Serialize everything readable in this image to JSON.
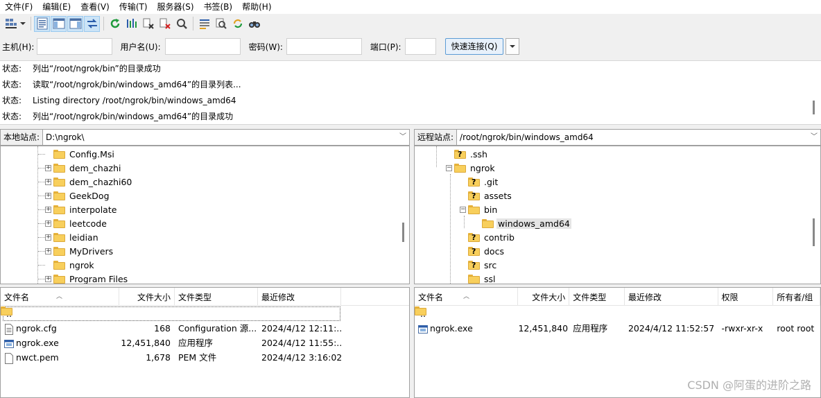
{
  "menu": [
    "文件(F)",
    "编辑(E)",
    "查看(V)",
    "传输(T)",
    "服务器(S)",
    "书签(B)",
    "帮助(H)"
  ],
  "toolbar": {
    "icons": [
      "site-manager-icon",
      "dropdown-arrow-icon",
      "message-log-icon",
      "local-tree-icon",
      "remote-tree-icon",
      "transfer-queue-icon",
      "refresh-icon",
      "process-queue-icon",
      "cancel-icon",
      "disconnect-icon",
      "reconnect-icon",
      "directory-filter-icon",
      "compare-icon",
      "sync-browse-icon",
      "search-files-icon"
    ]
  },
  "quickconnect": {
    "host_label": "主机(H):",
    "user_label": "用户名(U):",
    "pass_label": "密码(W):",
    "port_label": "端口(P):",
    "host_value": "",
    "user_value": "",
    "pass_value": "",
    "port_value": "",
    "connect_label": "快速连接(Q)"
  },
  "log": [
    {
      "k": "状态:",
      "v": "列出“/root/ngrok/bin”的目录成功"
    },
    {
      "k": "状态:",
      "v": "读取“/root/ngrok/bin/windows_amd64”的目录列表..."
    },
    {
      "k": "状态:",
      "v": "Listing directory /root/ngrok/bin/windows_amd64"
    },
    {
      "k": "状态:",
      "v": "列出“/root/ngrok/bin/windows_amd64”的目录成功"
    }
  ],
  "local": {
    "site_label": "本地站点:",
    "path": "D:\\ngrok\\",
    "tree": [
      {
        "name": "Config.Msi",
        "expander": false
      },
      {
        "name": "dem_chazhi",
        "expander": true
      },
      {
        "name": "dem_chazhi60",
        "expander": true
      },
      {
        "name": "GeekDog",
        "expander": true
      },
      {
        "name": "interpolate",
        "expander": true
      },
      {
        "name": "leetcode",
        "expander": true
      },
      {
        "name": "leidian",
        "expander": true
      },
      {
        "name": "MyDrivers",
        "expander": true
      },
      {
        "name": "ngrok",
        "expander": false
      },
      {
        "name": "Program Files",
        "expander": true
      }
    ],
    "columns": [
      "文件名",
      "文件大小",
      "文件类型",
      "最近修改"
    ],
    "files": [
      {
        "name": "..",
        "size": "",
        "type": "",
        "modified": "",
        "icon": "folder-icon"
      },
      {
        "name": "ngrok.cfg",
        "size": "168",
        "type": "Configuration 源...",
        "modified": "2024/4/12 12:11:...",
        "icon": "text-file-icon"
      },
      {
        "name": "ngrok.exe",
        "size": "12,451,840",
        "type": "应用程序",
        "modified": "2024/4/12 11:55:...",
        "icon": "exe-file-icon"
      },
      {
        "name": "nwct.pem",
        "size": "1,678",
        "type": "PEM 文件",
        "modified": "2024/4/12 3:16:02",
        "icon": "blank-file-icon"
      }
    ]
  },
  "remote": {
    "site_label": "远程站点:",
    "path": "/root/ngrok/bin/windows_amd64",
    "tree": [
      {
        "name": ".ssh",
        "unknown": true
      },
      {
        "name": "ngrok",
        "unknown": false,
        "expander": "−"
      },
      {
        "name": ".git",
        "unknown": true
      },
      {
        "name": "assets",
        "unknown": true
      },
      {
        "name": "bin",
        "unknown": false,
        "expander": "−"
      },
      {
        "name": "windows_amd64",
        "unknown": false,
        "selected": true
      },
      {
        "name": "contrib",
        "unknown": true
      },
      {
        "name": "docs",
        "unknown": true
      },
      {
        "name": "src",
        "unknown": true
      },
      {
        "name": "ssl",
        "unknown": false
      }
    ],
    "columns": [
      "文件名",
      "文件大小",
      "文件类型",
      "最近修改",
      "权限",
      "所有者/组"
    ],
    "files": [
      {
        "name": "..",
        "size": "",
        "type": "",
        "modified": "",
        "perm": "",
        "owner": "",
        "icon": "folder-icon"
      },
      {
        "name": "ngrok.exe",
        "size": "12,451,840",
        "type": "应用程序",
        "modified": "2024/4/12 11:52:57",
        "perm": "-rwxr-xr-x",
        "owner": "root root",
        "icon": "exe-file-icon"
      }
    ]
  },
  "watermark": "CSDN @阿蛋的进阶之路"
}
